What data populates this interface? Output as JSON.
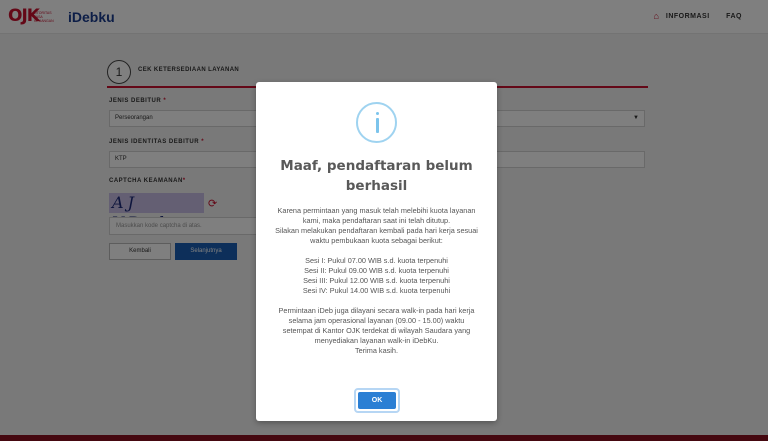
{
  "header": {
    "ojk_logo_text": "OJK",
    "ojk_logo_sub": "OTORITAS JASA KEUANGAN",
    "app_logo": "iDebku",
    "nav": {
      "info_label": "INFORMASI",
      "faq_label": "FAQ"
    }
  },
  "form": {
    "step_number": "1",
    "step_label": "CEK KETERSEDIAAN LAYANAN",
    "debtor_type_label": "JENIS DEBITUR",
    "debtor_type_value": "Perseorangan",
    "id_type_label": "JENIS IDENTITAS DEBITUR",
    "id_type_value": "KTP",
    "captcha_label": "CAPTCHA KEAMANAN",
    "captcha_text": "AJ VDph",
    "captcha_placeholder": "Masukkan kode captcha di atas.",
    "back_label": "Kembali",
    "next_label": "Selanjutnya",
    "required_mark": "*"
  },
  "modal": {
    "title_line1": "Maaf, pendaftaran belum",
    "title_line2": "berhasil",
    "body": [
      "Karena permintaan yang masuk telah melebihi kuota layanan",
      "kami, maka pendaftaran saat ini telah ditutup.",
      "Silakan melakukan pendaftaran kembali pada hari kerja sesuai",
      "waktu pembukaan kuota sebagai berikut:"
    ],
    "sessions": [
      "Sesi I: Pukul 07.00 WIB s.d. kuota terpenuhi",
      "Sesi II: Pukul 09.00 WIB s.d. kuota terpenuhi",
      "Sesi III: Pukul 12.00 WIB s.d. kuota terpenuhi",
      "Sesi IV: Pukul 14.00 WIB s.d. kuota terpenuhi"
    ],
    "footer": [
      "Permintaan iDeb juga dilayani secara walk-in pada hari kerja",
      "selama jam operasional layanan (09.00 - 15.00) waktu",
      "setempat di Kantor OJK terdekat di wilayah Saudara yang",
      "menyediakan layanan walk-in iDebKu.",
      "Terima kasih."
    ],
    "ok_label": "OK"
  },
  "colors": {
    "brand_red": "#c8102e",
    "brand_blue": "#1a3d8f",
    "ok_button": "#2b7fd4",
    "info_icon": "#9fd3f0"
  }
}
